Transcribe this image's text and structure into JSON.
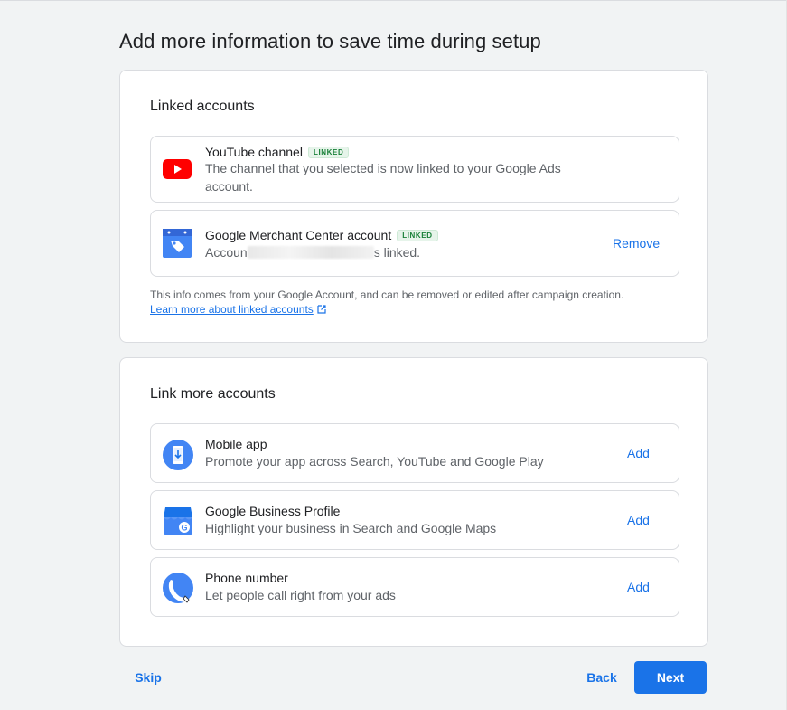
{
  "page": {
    "title": "Add more information to save time during setup"
  },
  "linked": {
    "title": "Linked accounts",
    "youtube": {
      "title": "YouTube channel",
      "badge": "LINKED",
      "desc": "The channel that you selected is now linked to your Google Ads account.",
      "icon": "youtube-icon"
    },
    "merchant": {
      "title": "Google Merchant Center account",
      "badge": "LINKED",
      "desc_prefix": "Accoun",
      "desc_suffix": "s linked.",
      "action": "Remove",
      "icon": "merchant-center-icon"
    },
    "footnote": "This info comes from your Google Account, and can be removed or edited after campaign creation.",
    "learn_more": "Learn more about linked accounts"
  },
  "more": {
    "title": "Link more accounts",
    "items": [
      {
        "title": "Mobile app",
        "desc": "Promote your app across Search, YouTube and Google Play",
        "action": "Add",
        "icon": "mobile-app-icon"
      },
      {
        "title": "Google Business Profile",
        "desc": "Highlight your business in Search and Google Maps",
        "action": "Add",
        "icon": "business-profile-icon"
      },
      {
        "title": "Phone number",
        "desc": "Let people call right from your ads",
        "action": "Add",
        "icon": "phone-icon"
      }
    ]
  },
  "footer": {
    "skip": "Skip",
    "back": "Back",
    "next": "Next"
  },
  "colors": {
    "accent": "#1a73e8",
    "youtube_red": "#ff0000",
    "linked_green": "#188038"
  }
}
